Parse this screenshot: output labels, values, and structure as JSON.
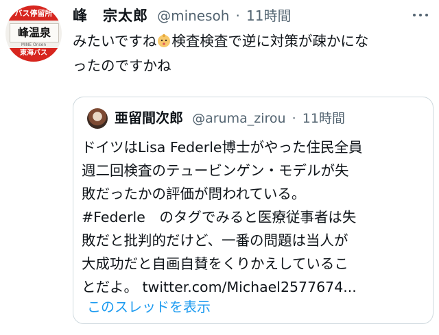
{
  "tweet": {
    "avatar": {
      "top": "バス停留所",
      "main": "峰温泉",
      "sub": "MINE Onsen",
      "bottom": "東海バス"
    },
    "display_name": "峰　宗太郎",
    "handle": "@minesoh",
    "separator": "·",
    "time": "11時間",
    "text_line1": "みたいですね",
    "emoji": "baby-face-emoji",
    "text_line1_rest": "検査検査で逆に対策が疎かにな",
    "text_line2": "ったのですかね"
  },
  "quote": {
    "display_name": "亜留間次郎",
    "handle": "@aruma_zirou",
    "separator": "·",
    "time": "11時間",
    "lines": [
      "ドイツはLisa Federle博士がやった住民全員",
      "週二回検査のテュービンゲン・モデルが失",
      "敗だったかの評価が問われている。",
      "#Federle　のタグでみると医療従事者は失",
      "敗だと批判的だけど、一番の問題は当人が",
      "大成功だと自画自賛をくりかえしているこ",
      "とだよ。 twitter.com/Michael2577674..."
    ],
    "show_thread": "このスレッドを表示"
  },
  "colors": {
    "text": "#0f1419",
    "secondary": "#536471",
    "link": "#1d9bf0",
    "border": "#cfd9de",
    "avatar_red": "#d7261f"
  },
  "icons": [
    "more-options-icon",
    "baby-face-emoji"
  ]
}
